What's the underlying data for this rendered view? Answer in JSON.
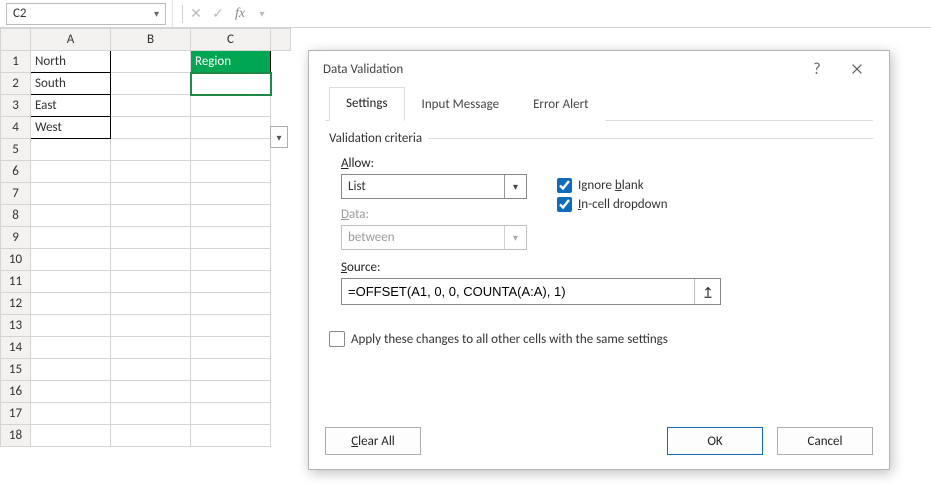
{
  "namebox": "C2",
  "fxlabel": "fx",
  "grid": {
    "columns": [
      "A",
      "B",
      "C"
    ],
    "rows_visible": 18,
    "dataA": [
      "North",
      "South",
      "East",
      "West"
    ],
    "regionHeader": "Region"
  },
  "chart_data": {
    "type": "table",
    "title": "",
    "series": [
      {
        "name": "A",
        "values": [
          "North",
          "South",
          "East",
          "West"
        ]
      },
      {
        "name": "C",
        "values": [
          "Region",
          ""
        ]
      }
    ]
  },
  "dialog": {
    "title": "Data Validation",
    "tabs": {
      "settings": "Settings",
      "input": "Input Message",
      "error": "Error Alert"
    },
    "groupLabel": "Validation criteria",
    "allow": {
      "label_pre": "",
      "label_ul": "A",
      "label_post": "llow:",
      "value": "List"
    },
    "data": {
      "label_pre": "",
      "label_ul": "D",
      "label_post": "ata:",
      "value": "between"
    },
    "source": {
      "label_pre": "",
      "label_ul": "S",
      "label_post": "ource:",
      "value": "=OFFSET(A1, 0, 0, COUNTA(A:A), 1)"
    },
    "ignoreBlank": {
      "pre": "Ignore ",
      "ul": "b",
      "post": "lank",
      "checked": true
    },
    "inCell": {
      "pre": "",
      "ul": "I",
      "post": "n-cell dropdown",
      "checked": true
    },
    "applyAll": {
      "pre": "Apply these changes to all other cells with the same settings",
      "checked": false
    },
    "buttons": {
      "clear_ul": "C",
      "clear_post": "lear All",
      "ok": "OK",
      "cancel": "Cancel"
    }
  }
}
